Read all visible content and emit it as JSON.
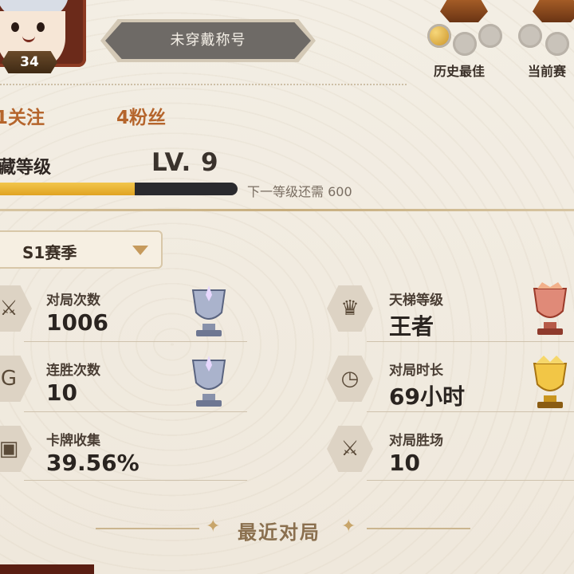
{
  "profile": {
    "level": "34",
    "title_plate": "未穿戴称号",
    "following": "1关注",
    "followers": "4粉丝"
  },
  "season_rank": {
    "best_label": "历史最佳",
    "current_label": "当前赛"
  },
  "collection": {
    "label": "藏等级",
    "level": "LV. 9",
    "progress_fraction": 0.58,
    "next_hint": "下一等级还需 600"
  },
  "season_select": {
    "selected": "S1赛季"
  },
  "stats": [
    {
      "label": "对局次数",
      "value": "1006",
      "icon": "crossed-swords-icon",
      "trophy": "silver-trophy-icon"
    },
    {
      "label": "天梯等级",
      "value": "王者",
      "icon": "crown-icon",
      "trophy": "red-trophy-icon"
    },
    {
      "label": "连胜次数",
      "value": "10",
      "icon": "streak-icon",
      "trophy": "silver-trophy-icon"
    },
    {
      "label": "对局时长",
      "value": "69小时",
      "icon": "clock-icon",
      "trophy": "gold-trophy-icon"
    },
    {
      "label": "卡牌收集",
      "value": "39.56%",
      "icon": "card-icon",
      "trophy": ""
    },
    {
      "label": "对局胜场",
      "value": "10",
      "icon": "victory-swords-icon",
      "trophy": ""
    }
  ],
  "recent": {
    "title": "最近对局"
  },
  "colors": {
    "accent_orange": "#b5652c",
    "xp_fill": "#e8b23a",
    "xp_track": "#2a2a2e"
  }
}
